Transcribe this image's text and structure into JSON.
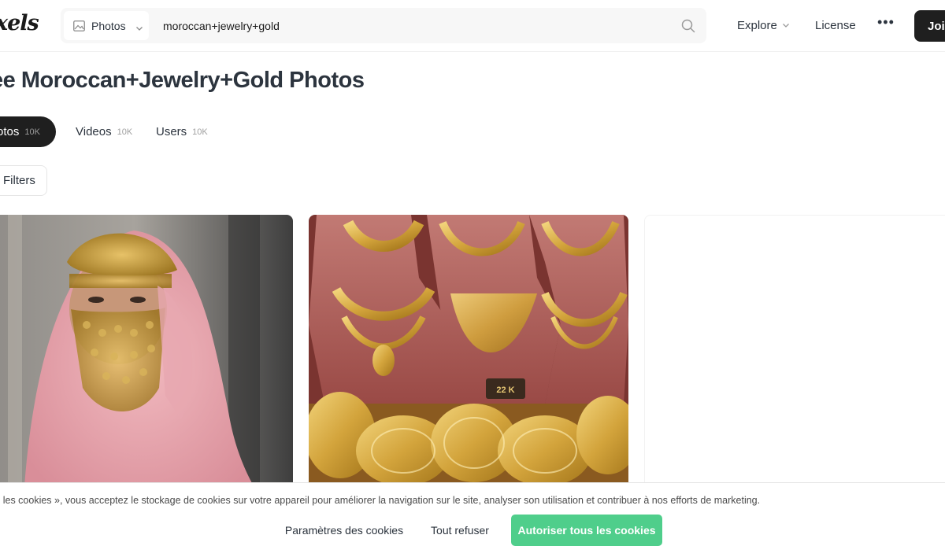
{
  "header": {
    "logo_text": "xels",
    "search_type_label": "Photos",
    "search_value": "moroccan+jewelry+gold",
    "nav": {
      "explore": "Explore",
      "license": "License",
      "more": "•••",
      "join": "Join"
    }
  },
  "page": {
    "title": "ee Moroccan+Jewelry+Gold Photos"
  },
  "tabs": [
    {
      "label": "otos",
      "count": "10K",
      "active": true
    },
    {
      "label": "Videos",
      "count": "10K",
      "active": false
    },
    {
      "label": "Users",
      "count": "10K",
      "active": false
    }
  ],
  "filters_label": "Filters",
  "cookie_banner": {
    "text": "s les cookies », vous acceptez le stockage de cookies sur votre appareil pour améliorer la navigation sur le site, analyser son utilisation et contribuer à nos efforts de marketing.",
    "settings_label": "Paramètres des cookies",
    "refuse_label": "Tout refuser",
    "accept_label": "Autoriser tous les cookies"
  },
  "colors": {
    "accent_green": "#4fce8b",
    "dark_button": "#1f1f1f",
    "text": "#2c343e"
  },
  "icons": {
    "search_type": "image-icon",
    "search": "search-icon",
    "dropdown": "chevron-down-icon"
  }
}
